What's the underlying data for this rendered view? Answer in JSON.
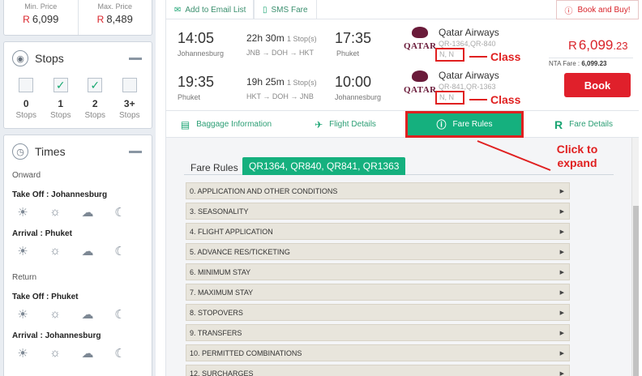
{
  "sidebar": {
    "min_price_label": "Min. Price",
    "min_price": "6,099",
    "max_price_label": "Max. Price",
    "max_price": "8,489",
    "currency": "R",
    "stops_title": "Stops",
    "stops": [
      {
        "n": "0",
        "label": "Stops",
        "checked": false
      },
      {
        "n": "1",
        "label": "Stops",
        "checked": true
      },
      {
        "n": "2",
        "label": "Stops",
        "checked": true
      },
      {
        "n": "3+",
        "label": "Stops",
        "checked": false
      }
    ],
    "times_title": "Times",
    "onward": "Onward",
    "return": "Return",
    "takeoff_jnb": "Take Off : Johannesburg",
    "arrival_hkt": "Arrival : Phuket",
    "takeoff_hkt": "Take Off : Phuket",
    "arrival_jnb": "Arrival : Johannesburg"
  },
  "topbar": {
    "email": "Add to Email List",
    "sms": "SMS Fare",
    "book_buy": "Book and Buy!"
  },
  "legs": [
    {
      "dep_time": "14:05",
      "dep_city": "Johannesburg",
      "duration": "22h 30m",
      "stops": "1 Stop(s)",
      "route": "JNB → DOH → HKT",
      "arr_time": "17:35",
      "arr_city": "Phuket",
      "airline": "Qatar Airways",
      "flights": "QR-1364,QR-840",
      "class": "N, N"
    },
    {
      "dep_time": "19:35",
      "dep_city": "Phuket",
      "duration": "19h 25m",
      "stops": "1 Stop(s)",
      "route": "HKT → DOH → JNB",
      "arr_time": "10:00",
      "arr_city": "Johannesburg",
      "airline": "Qatar Airways",
      "flights": "QR-841,QR-1363",
      "class": "N, N"
    }
  ],
  "logo_text": "QATAR",
  "annotations": {
    "class": "Class",
    "click": "Click to expand"
  },
  "fare": {
    "currency": "R",
    "amount": "6,099",
    "cents": ".23",
    "nta_label": "NTA Fare :",
    "nta_value": "6,099.23",
    "book": "Book"
  },
  "tabs": [
    {
      "label": "Baggage Information",
      "icon": "suitcase-icon"
    },
    {
      "label": "Flight Details",
      "icon": "plane-icon"
    },
    {
      "label": "Fare Rules",
      "icon": "info-icon",
      "active": true
    },
    {
      "label": "Fare Details",
      "icon": "rand-icon"
    }
  ],
  "fare_rules": {
    "title": "Fare Rules",
    "codes": "QR1364, QR840, QR841, QR1363",
    "items": [
      "0. APPLICATION AND OTHER CONDITIONS",
      "3. SEASONALITY",
      "4. FLIGHT APPLICATION",
      "5. ADVANCE RES/TICKETING",
      "6. MINIMUM STAY",
      "7. MAXIMUM STAY",
      "8. STOPOVERS",
      "9. TRANSFERS",
      "10. PERMITTED COMBINATIONS",
      "12. SURCHARGES"
    ]
  }
}
